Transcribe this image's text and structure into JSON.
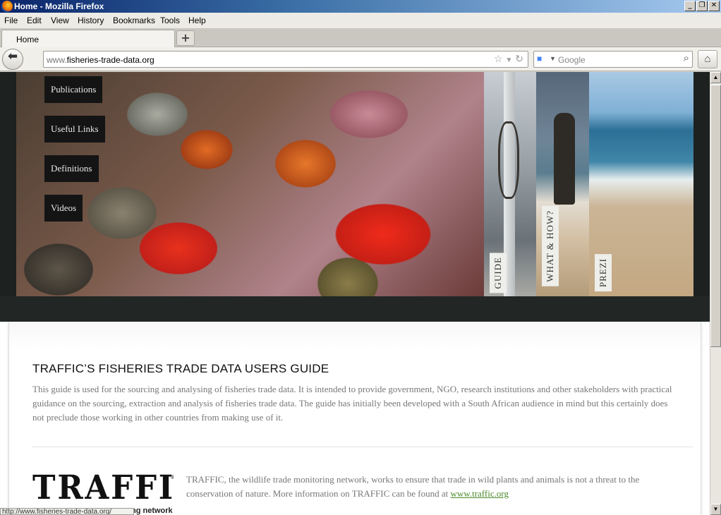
{
  "window": {
    "title": "Home - Mozilla Firefox"
  },
  "menubar": [
    "File",
    "Edit",
    "View",
    "History",
    "Bookmarks",
    "Tools",
    "Help"
  ],
  "tab": {
    "label": "Home",
    "new_tab_glyph": "+"
  },
  "nav": {
    "url_prefix": "www.",
    "url_domain": "fisheries-trade-data.org",
    "search_placeholder": "Google"
  },
  "site": {
    "menu": [
      "Publications",
      "Useful Links",
      "Definitions",
      "Videos"
    ],
    "panels": [
      "GUIDE",
      "WHAT & HOW?",
      "PREZI"
    ],
    "title": "TRAFFIC’S FISHERIES TRADE DATA USERS GUIDE",
    "intro": "This guide is used for the sourcing and analysing of fisheries trade data. It is intended to provide government, NGO, research institutions and other stakeholders with practical guidance on the sourcing, extraction and analysis of fisheries trade data.  The guide has initially been developed with a South African audience in mind but this certainly does not preclude those working in other countries from making use of it.",
    "traffic_logo": {
      "word": "TRAFFIC",
      "reg": "®",
      "tagline": "ng network"
    },
    "traffic_text": "TRAFFIC, the wildlife trade monitoring network, works to ensure that trade in wild plants and animals is not a threat to the conservation of nature. More information on TRAFFIC can be found at ",
    "traffic_link": "www.traffic.org"
  },
  "status": {
    "text": "http://www.fisheries-trade-data.org/"
  },
  "colors": {
    "header_bg": "#1d2120",
    "link": "#4a8a2a",
    "body_text": "#777777"
  }
}
